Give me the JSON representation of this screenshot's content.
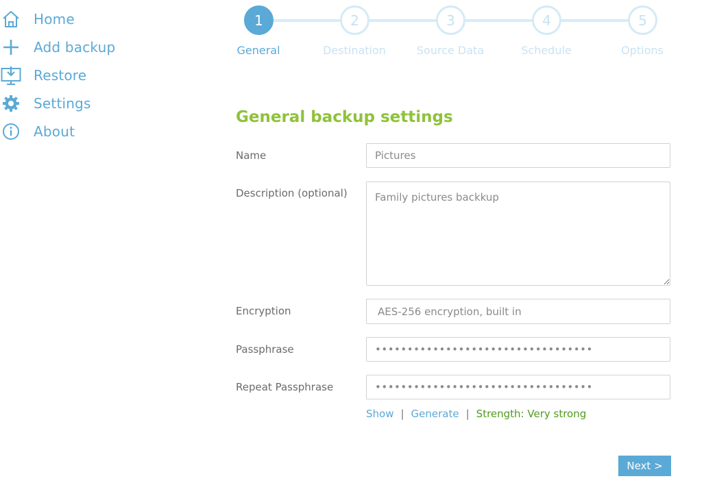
{
  "colors": {
    "accent": "#5aa9d6",
    "accent_light": "#d4eaf6",
    "title_green": "#8fc23a",
    "strength_green": "#4f9b1f"
  },
  "sidebar": {
    "items": [
      {
        "label": "Home",
        "icon": "home-icon"
      },
      {
        "label": "Add backup",
        "icon": "plus-icon"
      },
      {
        "label": "Restore",
        "icon": "restore-icon"
      },
      {
        "label": "Settings",
        "icon": "gear-icon"
      },
      {
        "label": "About",
        "icon": "info-icon"
      }
    ]
  },
  "stepper": {
    "active_step": 1,
    "steps": [
      {
        "number": "1",
        "label": "General"
      },
      {
        "number": "2",
        "label": "Destination"
      },
      {
        "number": "3",
        "label": "Source Data"
      },
      {
        "number": "4",
        "label": "Schedule"
      },
      {
        "number": "5",
        "label": "Options"
      }
    ]
  },
  "form": {
    "title": "General backup settings",
    "name": {
      "label": "Name",
      "value": "Pictures"
    },
    "description": {
      "label": "Description (optional)",
      "value": "Family pictures backkup"
    },
    "encryption": {
      "label": "Encryption",
      "value": "AES-256 encryption, built in"
    },
    "passphrase": {
      "label": "Passphrase",
      "value": "••••••••••••••••••••••••••••••••••"
    },
    "repeat_passphrase": {
      "label": "Repeat Passphrase",
      "value": "••••••••••••••••••••••••••••••••••"
    },
    "show_link": "Show",
    "separator": "|",
    "generate_link": "Generate",
    "strength": "Strength: Very strong"
  },
  "footer": {
    "next_label": "Next >"
  }
}
